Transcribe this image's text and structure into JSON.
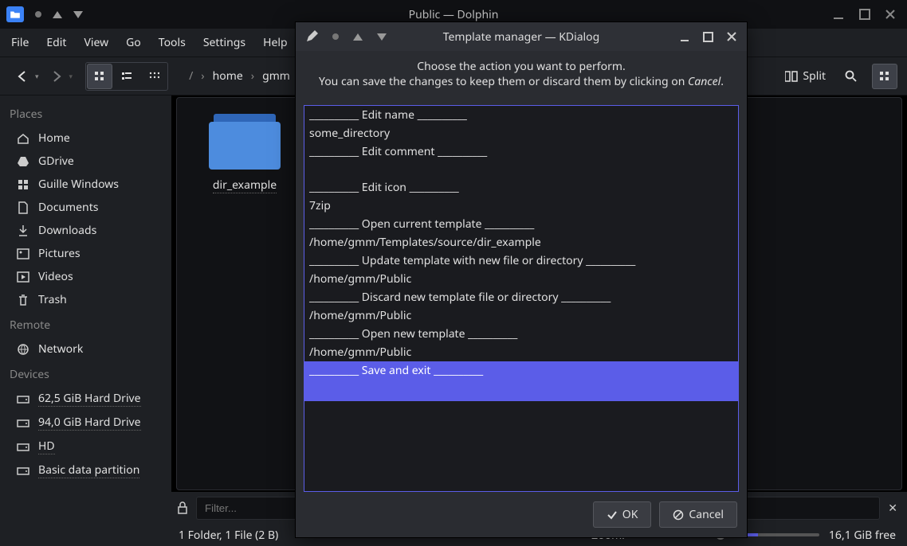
{
  "window": {
    "title": "Public — Dolphin"
  },
  "menu": [
    "File",
    "Edit",
    "View",
    "Go",
    "Tools",
    "Settings",
    "Help"
  ],
  "toolbar": {
    "split": "Split"
  },
  "breadcrumb": [
    "/",
    "home",
    "gmm"
  ],
  "sidebar": {
    "places": {
      "title": "Places",
      "items": [
        "Home",
        "GDrive",
        "Guille Windows",
        "Documents",
        "Downloads",
        "Pictures",
        "Videos",
        "Trash"
      ]
    },
    "remote": {
      "title": "Remote",
      "items": [
        "Network"
      ]
    },
    "devices": {
      "title": "Devices",
      "items": [
        "62,5 GiB Hard Drive",
        "94,0 GiB Hard Drive",
        "HD",
        "Basic data partition"
      ]
    }
  },
  "content": {
    "item1": "dir_example"
  },
  "filter": {
    "placeholder": "Filter..."
  },
  "status": {
    "info": "1 Folder, 1 File (2 B)",
    "zoom_label": "Zoom:",
    "free": "16,1 GiB free"
  },
  "dialog": {
    "title": "Template manager — KDialog",
    "line1": "Choose the action you want to perform.",
    "line2_a": "You can save the changes to keep them or discard them by clicking on ",
    "line2_b": "Cancel",
    "line2_c": ".",
    "rows": [
      "__________ Edit name __________",
      "some_directory",
      "__________ Edit comment __________",
      "",
      "__________ Edit icon __________",
      "7zip",
      "__________ Open current template __________",
      "/home/gmm/Templates/source/dir_example",
      "__________ Update template with new file or directory __________",
      "/home/gmm/Public",
      "__________ Discard new template file or directory __________",
      "/home/gmm/Public",
      "__________ Open new template __________",
      "/home/gmm/Public",
      "__________ Save and exit __________",
      ""
    ],
    "ok": "OK",
    "cancel": "Cancel"
  }
}
